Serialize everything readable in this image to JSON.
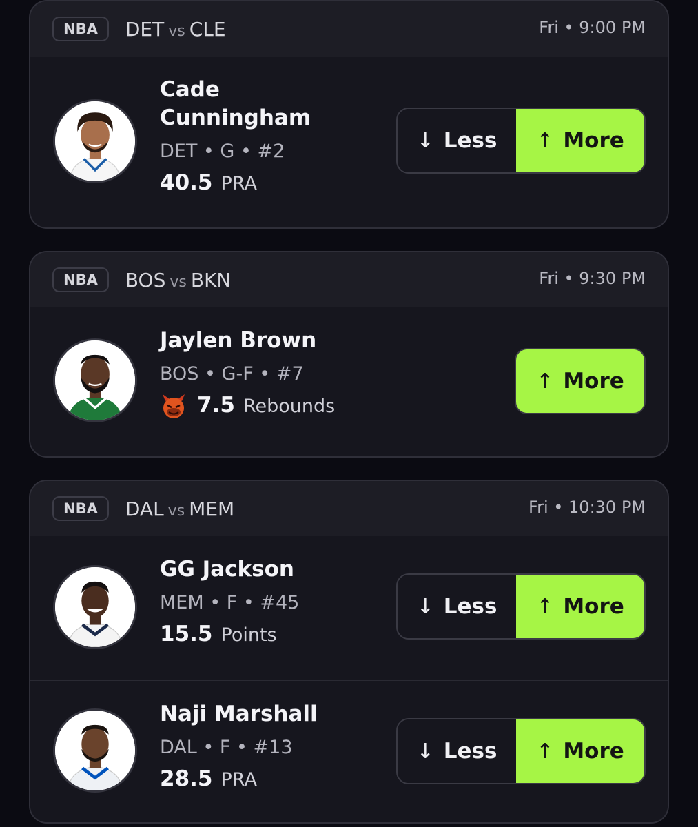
{
  "cards": [
    {
      "league": "NBA",
      "team_a": "DET",
      "vs": "vs",
      "team_b": "CLE",
      "time": "Fri • 9:00 PM",
      "players": [
        {
          "name": "Cade Cunningham",
          "meta": "DET • G • #2",
          "stat_value": "40.5",
          "stat_label": "PRA",
          "less_label": "Less",
          "more_label": "More",
          "less_arrow": "↓",
          "more_arrow": "↑",
          "jersey_color": "#ffffff",
          "skin_color": "#a86f4c",
          "hair_color": "#2a1a12"
        }
      ]
    },
    {
      "league": "NBA",
      "team_a": "BOS",
      "vs": "vs",
      "team_b": "BKN",
      "time": "Fri • 9:30 PM",
      "players": [
        {
          "name": "Jaylen Brown",
          "meta": "BOS • G-F • #7",
          "stat_value": "7.5",
          "stat_label": "Rebounds",
          "stat_icon": "demon-icon",
          "more_label": "More",
          "more_arrow": "↑",
          "jersey_color": "#1f7a3a",
          "skin_color": "#5a3826",
          "hair_color": "#141010"
        }
      ]
    },
    {
      "league": "NBA",
      "team_a": "DAL",
      "vs": "vs",
      "team_b": "MEM",
      "time": "Fri • 10:30 PM",
      "players": [
        {
          "name": "GG Jackson",
          "meta": "MEM • F • #45",
          "stat_value": "15.5",
          "stat_label": "Points",
          "less_label": "Less",
          "more_label": "More",
          "less_arrow": "↓",
          "more_arrow": "↑",
          "jersey_color": "#f4f4f4",
          "skin_color": "#4a2d1f",
          "hair_color": "#151010"
        },
        {
          "name": "Naji Marshall",
          "meta": "DAL • F • #13",
          "stat_value": "28.5",
          "stat_label": "PRA",
          "less_label": "Less",
          "more_label": "More",
          "less_arrow": "↓",
          "more_arrow": "↑",
          "jersey_color": "#eef1f5",
          "skin_color": "#6a432c",
          "hair_color": "#1b1410"
        }
      ]
    }
  ],
  "colors": {
    "background": "#0b0b12",
    "card": "#1d1d25",
    "row": "#16161e",
    "accent_green": "#a6f545",
    "text_primary": "#f4f4f8",
    "text_secondary": "#b4b4be"
  }
}
